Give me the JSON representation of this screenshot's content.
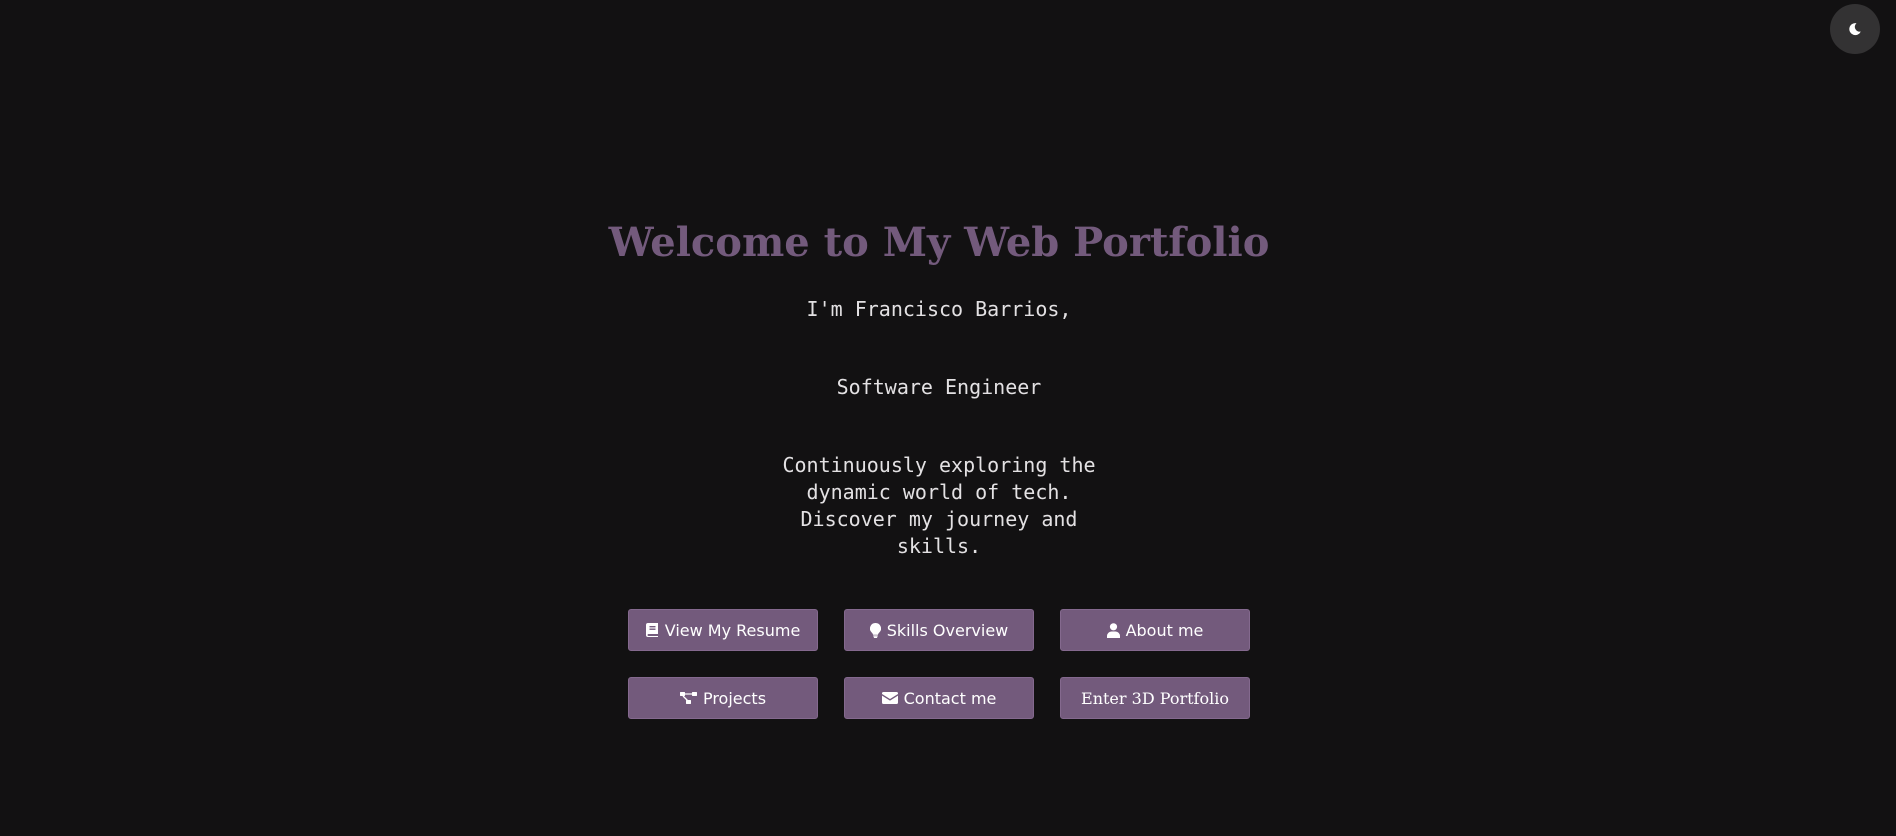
{
  "theme_toggle": {
    "icon": "moon-icon"
  },
  "hero": {
    "title": "Welcome to My Web Portfolio",
    "intro": "I'm Francisco Barrios,",
    "role": "Software Engineer",
    "tagline": "Continuously exploring the dynamic world of tech. Discover my journey and skills."
  },
  "buttons": [
    {
      "label": "View My Resume",
      "icon": "book-icon"
    },
    {
      "label": "Skills Overview",
      "icon": "lightbulb-icon"
    },
    {
      "label": "About me",
      "icon": "user-icon"
    },
    {
      "label": "Projects",
      "icon": "project-diagram-icon"
    },
    {
      "label": "Contact me",
      "icon": "envelope-icon"
    },
    {
      "label": "Enter 3D Portfolio"
    }
  ],
  "colors": {
    "background": "#121112",
    "accent": "#735a7c",
    "text": "#e3e1e3",
    "toggle_bg": "#333233"
  }
}
